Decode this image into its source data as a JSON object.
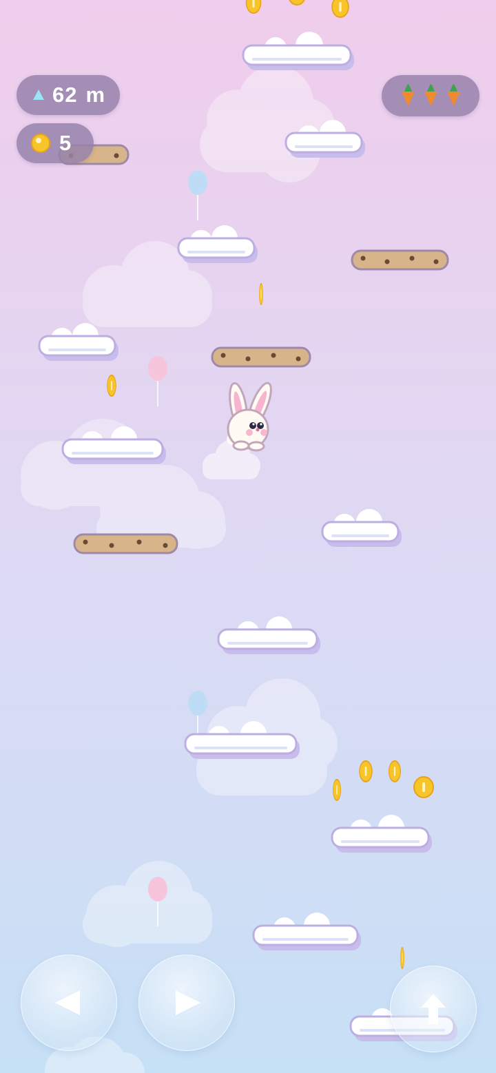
{
  "hud": {
    "height_value": "62",
    "height_unit": "m",
    "coins": "5",
    "lives": {
      "count": 3,
      "icon": "carrot-icon"
    }
  },
  "controls": {
    "left": {
      "icon": "arrow-left-icon"
    },
    "right": {
      "icon": "arrow-right-icon"
    },
    "jump": {
      "icon": "arrow-up-icon"
    }
  },
  "colors": {
    "sky_top": "#f0cdec",
    "sky_mid": "#dcdaf4",
    "sky_bottom": "#c6e0f6",
    "cloud_platform": "#ffffff",
    "cloud_outline": "#bcaee0",
    "cookie_platform": "#d8b48a",
    "coin": "#f7c52a",
    "carrot": "#f08a2e",
    "balloon_blue": "#bfdcf6",
    "balloon_pink": "#f6c5dc"
  }
}
